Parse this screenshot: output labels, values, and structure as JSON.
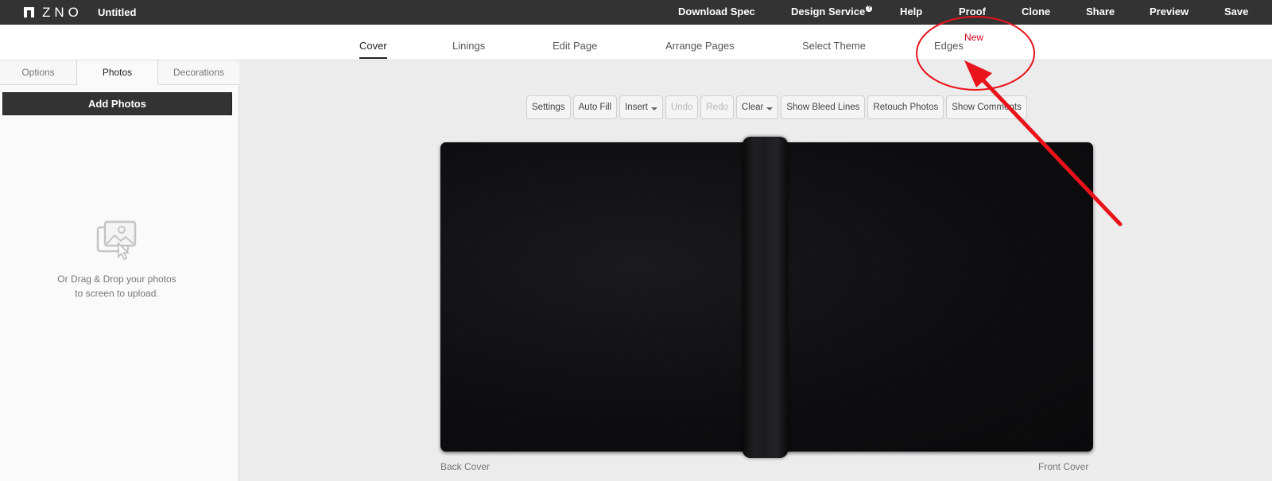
{
  "app": {
    "logo_text": "ZNO",
    "document_title": "Untitled"
  },
  "top_nav": [
    {
      "label": "Download Spec"
    },
    {
      "label": "Design Service",
      "badge": "?"
    },
    {
      "label": "Help"
    },
    {
      "label": "Proof"
    },
    {
      "label": "Clone"
    },
    {
      "label": "Share"
    },
    {
      "label": "Preview"
    },
    {
      "label": "Save"
    }
  ],
  "sub_tabs": [
    {
      "label": "Cover",
      "active": true
    },
    {
      "label": "Linings"
    },
    {
      "label": "Edit Page"
    },
    {
      "label": "Arrange Pages"
    },
    {
      "label": "Select Theme"
    },
    {
      "label": "Edges",
      "badge": "New"
    }
  ],
  "sidebar": {
    "tabs": [
      {
        "label": "Options"
      },
      {
        "label": "Photos",
        "active": true
      },
      {
        "label": "Decorations"
      }
    ],
    "add_photos_label": "Add Photos",
    "drop_text_line1": "Or Drag & Drop your photos",
    "drop_text_line2": "to screen to upload."
  },
  "toolbar": [
    {
      "label": "Settings"
    },
    {
      "label": "Auto Fill"
    },
    {
      "label": "Insert",
      "dropdown": true
    },
    {
      "label": "Undo",
      "disabled": true
    },
    {
      "label": "Redo",
      "disabled": true
    },
    {
      "label": "Clear",
      "dropdown": true
    },
    {
      "label": "Show Bleed Lines"
    },
    {
      "label": "Retouch Photos"
    },
    {
      "label": "Show Comments"
    }
  ],
  "canvas": {
    "back_cover_label": "Back Cover",
    "front_cover_label": "Front Cover"
  },
  "colors": {
    "topbar_bg": "#333333",
    "annotation_red": "#e8131b",
    "new_badge": "#d0021b"
  }
}
